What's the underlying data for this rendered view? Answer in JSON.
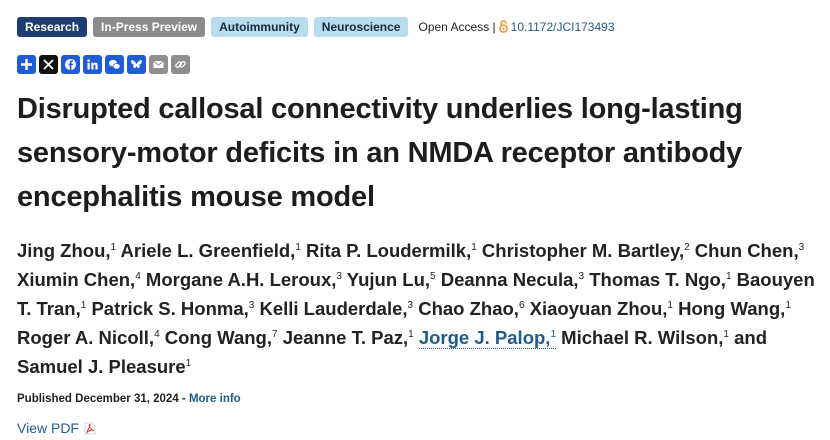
{
  "tags": {
    "research": "Research",
    "in_press": "In-Press Preview",
    "autoimmunity": "Autoimmunity",
    "neuroscience": "Neuroscience"
  },
  "access": {
    "label": "Open Access |",
    "doi": "10.1172/JCI173493"
  },
  "share": {
    "icons": [
      "share-plus-icon",
      "x-icon",
      "facebook-icon",
      "linkedin-icon",
      "wechat-icon",
      "bluesky-icon",
      "email-icon",
      "link-icon"
    ]
  },
  "article": {
    "title": "Disrupted callosal connectivity underlies long-lasting sensory-motor deficits in an NMDA receptor antibody encephalitis mouse model"
  },
  "authors": [
    {
      "name": "Jing Zhou,",
      "aff": "1"
    },
    {
      "name": "Ariele L. Greenfield,",
      "aff": "1"
    },
    {
      "name": "Rita P. Loudermilk,",
      "aff": "1"
    },
    {
      "name": "Christopher M. Bartley,",
      "aff": "2"
    },
    {
      "name": "Chun Chen,",
      "aff": "3"
    },
    {
      "name": "Xiumin Chen,",
      "aff": "4"
    },
    {
      "name": "Morgane A.H. Leroux,",
      "aff": "3"
    },
    {
      "name": "Yujun Lu,",
      "aff": "5"
    },
    {
      "name": "Deanna Necula,",
      "aff": "3"
    },
    {
      "name": "Thomas T. Ngo,",
      "aff": "1"
    },
    {
      "name": "Baouyen T. Tran,",
      "aff": "1"
    },
    {
      "name": "Patrick S. Honma,",
      "aff": "3"
    },
    {
      "name": "Kelli Lauderdale,",
      "aff": "3"
    },
    {
      "name": "Chao Zhao,",
      "aff": "6"
    },
    {
      "name": "Xiaoyuan Zhou,",
      "aff": "1"
    },
    {
      "name": "Hong Wang,",
      "aff": "1"
    },
    {
      "name": "Roger A. Nicoll,",
      "aff": "4"
    },
    {
      "name": "Cong Wang,",
      "aff": "7"
    },
    {
      "name": "Jeanne T. Paz,",
      "aff": "1"
    },
    {
      "name": "Jorge J. Palop,",
      "aff": "1"
    },
    {
      "name": "Michael R. Wilson,",
      "aff": "1"
    },
    {
      "name": "and Samuel J. Pleasure",
      "aff": "1"
    }
  ],
  "publication": {
    "published": "Published December 31, 2024 -",
    "more_info": "More info"
  },
  "pdf": {
    "label": "View PDF"
  },
  "colors": {
    "research": "#1f3c73",
    "in_press": "#8b8b8b",
    "topic": "#b8dced",
    "link": "#1f5c8a",
    "share": "#1f5cd6"
  }
}
